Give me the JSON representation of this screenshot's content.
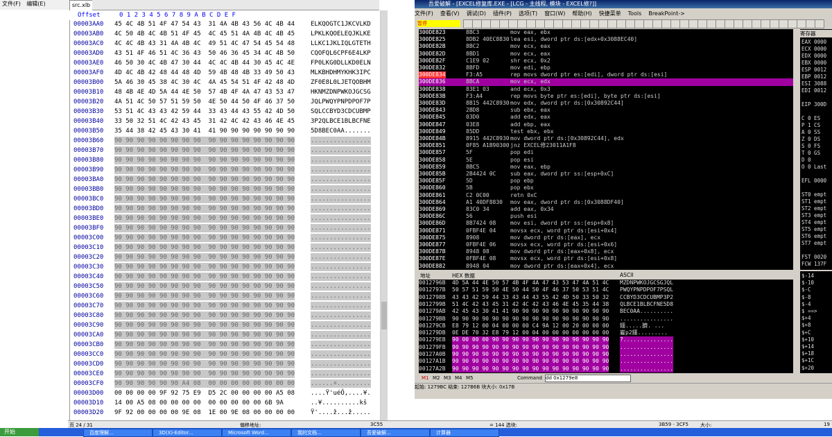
{
  "left": {
    "menu": [
      "文件(F)",
      "编辑(E)"
    ],
    "file_tab": "src.xlb",
    "offset_header": "Offset",
    "col_header": "0 1 2 3 4 5 6 7   8 9 A B C D E F",
    "rows": [
      {
        "a": "00003AA0",
        "h": "45 4C 4B 51 4F 47 54 43  31 4A 4B 43 56 4C 4B 44",
        "s": "ELKQOGTC1JKCVLKD",
        "g": false
      },
      {
        "a": "00003AB0",
        "h": "4C 50 4B 4C 4B 51 4F 45  4C 45 51 4A 4B 4C 4B 45",
        "s": "LPKLKQOELEQJKLKE",
        "g": false
      },
      {
        "a": "00003AC0",
        "h": "4C 4C 4B 43 31 4A 4B 4C  49 51 4C 47 54 45 54 48",
        "s": "LLKC1JKLIQLGTETH",
        "g": false
      },
      {
        "a": "00003AD0",
        "h": "43 51 4F 46 51 4C 36 43  50 46 36 45 34 4C 4B 50",
        "s": "CQOFQL6CPF6E4LKP",
        "g": false
      },
      {
        "a": "00003AE0",
        "h": "46 50 30 4C 4B 47 30 44  4C 4C 4B 44 30 45 4C 4E",
        "s": "FP0LKG0DLLKD0ELN",
        "g": false
      },
      {
        "a": "00003AF0",
        "h": "4D 4C 4B 42 48 44 48 4D  59 4B 48 4B 33 49 50 43",
        "s": "MLKBHDHMYKHK3IPC",
        "g": false
      },
      {
        "a": "00003B00",
        "h": "5A 46 30 45 38 4C 30 4C  4A 45 54 51 4F 42 48 4D",
        "s": "ZF0E8L0LJETQOBHM",
        "g": false
      },
      {
        "a": "00003B10",
        "h": "48 4B 4E 4D 5A 44 4E 50  57 4B 4F 4A 47 43 53 47",
        "s": "HKNMZDNPWKOJGCSG",
        "g": false
      },
      {
        "a": "00003B20",
        "h": "4A 51 4C 50 57 51 59 50  4E 50 44 50 4F 46 37 50",
        "s": "JQLPWQYPNPDPOF7P",
        "g": false
      },
      {
        "a": "00003B30",
        "h": "53 51 4C 43 43 42 59 44  33 43 44 43 55 42 4D 50",
        "s": "SQLCCBYD3CDCUBMP",
        "g": false
      },
      {
        "a": "00003B40",
        "h": "33 50 32 51 4C 42 43 45  31 42 4C 42 43 46 4E 45",
        "s": "3P2QLBCE1BLBCFNE",
        "g": false
      },
      {
        "a": "00003B50",
        "h": "35 44 38 42 45 43 30 41  41 90 90 90 90 90 90 90",
        "s": "5D8BEC0AA.......",
        "g": false
      },
      {
        "a": "00003B60",
        "h": "90 90 90 90 90 90 90 90  90 90 90 90 90 90 90 90",
        "s": "................",
        "g": true
      },
      {
        "a": "00003B70",
        "h": "90 90 90 90 90 90 90 90  90 90 90 90 90 90 90 90",
        "s": "................",
        "g": true
      },
      {
        "a": "00003B80",
        "h": "90 90 90 90 90 90 90 90  90 90 90 90 90 90 90 90",
        "s": "................",
        "g": true
      },
      {
        "a": "00003B90",
        "h": "90 90 90 90 90 90 90 90  90 90 90 90 90 90 90 90",
        "s": "................",
        "g": true
      },
      {
        "a": "00003BA0",
        "h": "90 90 90 90 90 90 90 90  90 90 90 90 90 90 90 90",
        "s": "................",
        "g": true
      },
      {
        "a": "00003BB0",
        "h": "90 90 90 90 90 90 90 90  90 90 90 90 90 90 90 90",
        "s": "................",
        "g": true
      },
      {
        "a": "00003BC0",
        "h": "90 90 90 90 90 90 90 90  90 90 90 90 90 90 90 90",
        "s": "................",
        "g": true
      },
      {
        "a": "00003BD0",
        "h": "90 90 90 90 90 90 90 90  90 90 90 90 90 90 90 90",
        "s": "................",
        "g": true
      },
      {
        "a": "00003BE0",
        "h": "90 90 90 90 90 90 90 90  90 90 90 90 90 90 90 90",
        "s": "................",
        "g": true
      },
      {
        "a": "00003BF0",
        "h": "90 90 90 90 90 90 90 90  90 90 90 90 90 90 90 90",
        "s": "................",
        "g": true
      },
      {
        "a": "00003C00",
        "h": "90 90 90 90 90 90 90 90  90 90 90 90 90 90 90 90",
        "s": "................",
        "g": true
      },
      {
        "a": "00003C10",
        "h": "90 90 90 90 90 90 90 90  90 90 90 90 90 90 90 90",
        "s": "................",
        "g": true
      },
      {
        "a": "00003C20",
        "h": "90 90 90 90 90 90 90 90  90 90 90 90 90 90 90 90",
        "s": "................",
        "g": true
      },
      {
        "a": "00003C30",
        "h": "90 90 90 90 90 90 90 90  90 90 90 90 90 90 90 90",
        "s": "................",
        "g": true
      },
      {
        "a": "00003C40",
        "h": "90 90 90 90 90 90 90 90  90 90 90 90 90 90 90 90",
        "s": "................",
        "g": true
      },
      {
        "a": "00003C50",
        "h": "90 90 90 90 90 90 90 90  90 90 90 90 90 90 90 90",
        "s": "................",
        "g": true
      },
      {
        "a": "00003C60",
        "h": "90 90 90 90 90 90 90 90  90 90 90 90 90 90 90 90",
        "s": "................",
        "g": true
      },
      {
        "a": "00003C70",
        "h": "90 90 90 90 90 90 90 90  90 90 90 90 90 90 90 90",
        "s": "................",
        "g": true
      },
      {
        "a": "00003C80",
        "h": "90 90 90 90 90 90 90 90  90 90 90 90 90 90 90 90",
        "s": "................",
        "g": true
      },
      {
        "a": "00003C90",
        "h": "90 90 90 90 90 90 90 90  90 90 90 90 90 90 90 90",
        "s": "................",
        "g": true
      },
      {
        "a": "00003CA0",
        "h": "90 90 90 90 90 90 90 90  90 90 90 90 90 90 90 90",
        "s": "................",
        "g": true
      },
      {
        "a": "00003CB0",
        "h": "90 90 90 90 90 90 90 90  90 90 90 90 90 90 90 90",
        "s": "................",
        "g": true
      },
      {
        "a": "00003CC0",
        "h": "90 90 90 90 90 90 90 90  90 90 90 90 90 90 90 90",
        "s": "................",
        "g": true
      },
      {
        "a": "00003CD0",
        "h": "90 90 90 90 90 90 90 90  90 90 90 90 90 90 90 90",
        "s": "................",
        "g": true
      },
      {
        "a": "00003CE0",
        "h": "90 90 90 90 90 90 90 90  90 90 90 90 90 90 90 90",
        "s": "................",
        "g": true
      },
      {
        "a": "00003CF0",
        "h": "90 90 90 90 90 90 A4 08  00 00 00 00 00 00 00 00",
        "s": "......¤.........",
        "g": true
      },
      {
        "a": "00003D00",
        "h": "00 00 00 00 9F 92 75 E9  D5 2C 00 00 00 00 A5 08",
        "s": "....Ÿ'uéÕ,....¥.",
        "g": false
      },
      {
        "a": "00003D10",
        "h": "14 00 A5 08 00 00 00 00  00 00 00 00 00 6B 9A",
        "s": "..¥..........kš",
        "g": false
      },
      {
        "a": "00003D20",
        "h": "9F 92 00 00 00 00 9E 08  1E 00 9E 08 00 00 00 00",
        "s": "Ÿ'....ž...ž.....",
        "g": false
      }
    ],
    "status": {
      "page": "页 24 / 31",
      "label": "偏移地址:",
      "offset": "3C55",
      "eq": "= 144 选块:",
      "range": "3B59 - 3CF5",
      "size": "大小:",
      "num": "19"
    }
  },
  "debugger": {
    "title": "吾爱破解 - [EXCEL修复库.EXE - [LCG - 主线程, 模块 - EXCEL修?]]",
    "menu": [
      "文件(F)",
      "查看(V)",
      "调试(D)",
      "插件(P)",
      "选项(T)",
      "窗口(W)",
      "帮助(H)",
      "快捷菜单",
      "Tools",
      "BreakPoint->"
    ],
    "pause": "暂停",
    "asm": [
      {
        "a": "300DE823",
        "b": "8BC3",
        "c": "mov eax, ebx",
        "hl": false,
        "bp": false
      },
      {
        "a": "300DE825",
        "b": "8DB2 40EC8830",
        "c": "lea esi, dword ptr ds:[edx+0x3088EC40]",
        "hl": false,
        "bp": false
      },
      {
        "a": "300DE82B",
        "b": "8BC2",
        "c": "mov ecx, eax",
        "hl": false,
        "bp": false
      },
      {
        "a": "300DE82D",
        "b": "8BD1",
        "c": "mov ecx, eax",
        "hl": false,
        "bp": false
      },
      {
        "a": "300DE82F",
        "b": "C1E9 02",
        "c": "shr ecx, 0x2",
        "hl": false,
        "bp": false
      },
      {
        "a": "300DE832",
        "b": "8BFD",
        "c": "mov edi, ebp",
        "hl": false,
        "bp": false
      },
      {
        "a": "300DE834",
        "b": "F3:A5",
        "c": "rep movs dword ptr es:[edi], dword ptr ds:[esi]",
        "hl": false,
        "bp": true
      },
      {
        "a": "300DE836",
        "b": "8BCA",
        "c": "mov ecx, edx",
        "hl": true,
        "bp": false
      },
      {
        "a": "300DE838",
        "b": "83E1 03",
        "c": "and ecx, 0x3",
        "hl": false,
        "bp": false
      },
      {
        "a": "300DE83B",
        "b": "F3:A4",
        "c": "rep movs byte ptr es:[edi], byte ptr ds:[esi]",
        "hl": false,
        "bp": false
      },
      {
        "a": "300DE83D",
        "b": "8B15 442C8930",
        "c": "mov edx, dword ptr ds:[0x30892C44]",
        "hl": false,
        "bp": false
      },
      {
        "a": "300DE843",
        "b": "2BD8",
        "c": "sub ebx, eax",
        "hl": false,
        "bp": false
      },
      {
        "a": "300DE845",
        "b": "03D0",
        "c": "add edx, eax",
        "hl": false,
        "bp": false
      },
      {
        "a": "300DE847",
        "b": "03E8",
        "c": "add ebp, eax",
        "hl": false,
        "bp": false
      },
      {
        "a": "300DE849",
        "b": "85DD",
        "c": "test ebx, ebx",
        "hl": false,
        "bp": false
      },
      {
        "a": "300DE84B",
        "b": "8915 442C8930",
        "c": "mov dword ptr ds:[0x30892C44], edx",
        "hl": false,
        "bp": false
      },
      {
        "a": "300DE851",
        "b": "0F85 A1B90300",
        "c": "jnz EXCEL修23011A1F8",
        "hl": false,
        "bp": false
      },
      {
        "a": "300DE857",
        "b": "5F",
        "c": "pop edi",
        "hl": false,
        "bp": false
      },
      {
        "a": "300DE858",
        "b": "5E",
        "c": "pop esi",
        "hl": false,
        "bp": false
      },
      {
        "a": "300DE859",
        "b": "8BC5",
        "c": "mov eax, ebp",
        "hl": false,
        "bp": false
      },
      {
        "a": "300DE85B",
        "b": "2B4424 0C",
        "c": "sub eax, dword ptr ss:[esp+0xC]",
        "hl": false,
        "bp": false
      },
      {
        "a": "300DE85F",
        "b": "5D",
        "c": "pop ebp",
        "hl": false,
        "bp": false
      },
      {
        "a": "300DE860",
        "b": "5B",
        "c": "pop ebx",
        "hl": false,
        "bp": false
      },
      {
        "a": "300DE861",
        "b": "C2 0C00",
        "c": "retn 0xC",
        "hl": false,
        "bp": false
      },
      {
        "a": "300DE864",
        "b": "A1 40DF8830",
        "c": "mov eax, dword ptr ds:[0x3088DF40]",
        "hl": false,
        "bp": false
      },
      {
        "a": "300DE869",
        "b": "83C0 34",
        "c": "add eax, 0x34",
        "hl": false,
        "bp": false
      },
      {
        "a": "300DE86C",
        "b": "56",
        "c": "push esi",
        "hl": false,
        "bp": false
      },
      {
        "a": "300DE86D",
        "b": "8B7424 08",
        "c": "mov esi, dword ptr ss:[esp+0x8]",
        "hl": false,
        "bp": false
      },
      {
        "a": "300DE871",
        "b": "0FBF4E 04",
        "c": "movsx ecx, word ptr ds:[esi+0x4]",
        "hl": false,
        "bp": false
      },
      {
        "a": "300DE875",
        "b": "8908",
        "c": "mov dword ptr ds:[eax], ecx",
        "hl": false,
        "bp": false
      },
      {
        "a": "300DE877",
        "b": "0FBF4E 06",
        "c": "movsx ecx, word ptr ds:[esi+0x6]",
        "hl": false,
        "bp": false
      },
      {
        "a": "300DE87B",
        "b": "8948 08",
        "c": "mov dword ptr ds:[eax+0x8], ecx",
        "hl": false,
        "bp": false
      },
      {
        "a": "300DE87E",
        "b": "0FBF4E 08",
        "c": "movsx ecx, word ptr ds:[esi+0x8]",
        "hl": false,
        "bp": false
      },
      {
        "a": "300DE882",
        "b": "8948 04",
        "c": "mov dword ptr ds:[eax+0x4], ecx",
        "hl": false,
        "bp": false
      }
    ],
    "regs_title": "寄存器",
    "regs": [
      "EAX 0000",
      "ECX 0000",
      "EDX 0000",
      "EBX 0000",
      "ESP 0012",
      "EBP 0012",
      "ESI 3088",
      "EDI 0012",
      "",
      "EIP 300D",
      "",
      "C 0 ES",
      "P 1 CS",
      "A 0 SS",
      "Z 0 DS",
      "S 0 FS",
      "T 0 GS",
      "D 0",
      "O 0 Last",
      "",
      "EFL 0000",
      "",
      "ST0 empt",
      "ST1 empt",
      "ST2 empt",
      "ST3 empt",
      "ST4 empt",
      "ST5 empt",
      "ST6 empt",
      "ST7 empt",
      "",
      "FST 0020",
      "FCW 137F"
    ],
    "dump_head": {
      "addr": "地址",
      "hex": "HEX 数据",
      "ascii": "ASCII"
    },
    "dump": [
      {
        "a": "0012796B",
        "h": "4D 5A 44 4E 50 57 4B 4F 4A 47 43 53 47 4A 51 4C",
        "s": "MZDNPWKOJGCSGJQL",
        "m": false
      },
      {
        "a": "0012797B",
        "h": "50 57 51 59 50 4E 50 44 50 4F 46 37 50 53 51 4C",
        "s": "PWQYPNPDPOF7PSQL",
        "m": false
      },
      {
        "a": "0012798B",
        "h": "43 43 42 59 44 33 43 44 43 55 42 4D 50 33 50 32",
        "s": "CCBYD3CDCUBMP3P2",
        "m": false
      },
      {
        "a": "0012799B",
        "h": "51 4C 42 43 45 31 42 4C 42 43 46 4E 45 35 44 38",
        "s": "QLBCE1BLBCFNE5D8",
        "m": false
      },
      {
        "a": "001279AB",
        "h": "42 45 43 30 41 41 90 90 90 90 90 90 90 90 90 90",
        "s": "BEC0AA..........",
        "m": false
      },
      {
        "a": "001279BB",
        "h": "90 90 90 90 90 90 90 90 90 90 90 90 90 90 90 90",
        "s": "................",
        "m": false
      },
      {
        "a": "001279CB",
        "h": "E8 79 12 00 04 00 00 00 C4 9A 12 00 20 00 00 00",
        "s": "鑩.....臍. ...",
        "m": false
      },
      {
        "a": "001279DB",
        "h": "0E DE 70 32 E8 79 12 00 04 00 00 00 00 00 00 00",
        "s": "嵟p2鑩.........",
        "m": false
      },
      {
        "a": "001279EB",
        "h": "90 00 00 00 90 90 90 90 90 90 90 90 90 90 90 90",
        "s": "?...............",
        "m": true
      },
      {
        "a": "001279FB",
        "h": "90 90 90 90 90 90 90 90 90 90 90 90 90 90 90 90",
        "s": "................",
        "m": true
      },
      {
        "a": "00127A0B",
        "h": "90 90 90 90 90 90 90 90 90 90 90 90 90 90 90 90",
        "s": "................",
        "m": true
      },
      {
        "a": "00127A1B",
        "h": "90 90 90 90 90 90 90 90 90 90 90 90 90 90 90 90",
        "s": "................",
        "m": true
      },
      {
        "a": "00127A2B",
        "h": "90 90 90 90 90 90 90 90 90 90 90 90 90 90 90 90",
        "s": "................",
        "m": true
      }
    ],
    "stack": [
      "$-14",
      "$-10",
      "$-C",
      "$-8",
      "$-4",
      "$ ==>",
      "$+4",
      "$+8",
      "$+C",
      "$+10",
      "$+14",
      "$+18",
      "$+1C",
      "$+20"
    ],
    "cmd_tabs": [
      "M1",
      "M2",
      "M3",
      "M4",
      "M5"
    ],
    "cmd_label": "Command",
    "cmd_value": "dd 0x1279e8",
    "status": "起始: 1279BC 结束: 127B6B 块大小: 0x17B"
  },
  "taskbar": {
    "start": "开始",
    "tasks": [
      "百度理解...",
      "3D(X)-Editor...",
      "Microsoft Word...",
      "我的文档...",
      "吾爱破解...",
      "计算器"
    ]
  }
}
